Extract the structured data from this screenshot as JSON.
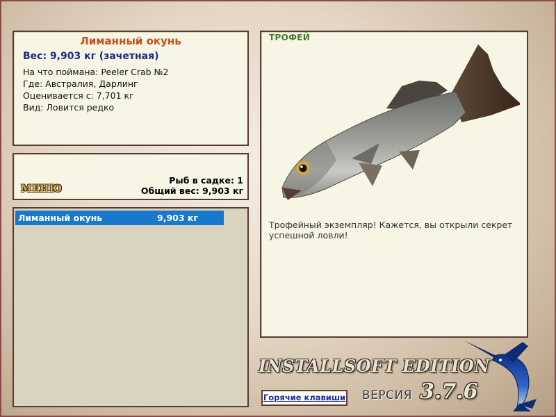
{
  "fish_info": {
    "title": "Лиманный окунь",
    "weight_line": "Вес: 9,903 кг (зачетная)",
    "caught_with": "На что поймана: Peeler Crab №2",
    "location": "Где: Австралия, Дарлинг",
    "valued_from": "Оценивается с: 7,701 кг",
    "kind": "Вид: Ловится редко"
  },
  "stats": {
    "menu_label": "МЕНЮ",
    "fish_count": "Рыб в садке: 1",
    "total_weight": "Общий вес: 9,903 кг"
  },
  "catch_list": [
    {
      "name": "Лиманный окунь",
      "weight": "9,903 кг"
    }
  ],
  "trophy": {
    "label": "ТРОФЕЙ",
    "text": "Трофейный экземпляр! Кажется, вы открыли секрет успешной ловли!"
  },
  "footer": {
    "edition": "INSTALLSOFT EDITION",
    "hotkeys_label": "Горячие клавиши",
    "version_label": "ВЕРСИЯ",
    "version_number": "3.7.6"
  },
  "colors": {
    "fish_title": "#c3501a",
    "weight_line": "#1c2a86",
    "selected_row": "#1878cc",
    "trophy_label": "#3f7d2a",
    "panel_bg": "#f7f6e4"
  }
}
